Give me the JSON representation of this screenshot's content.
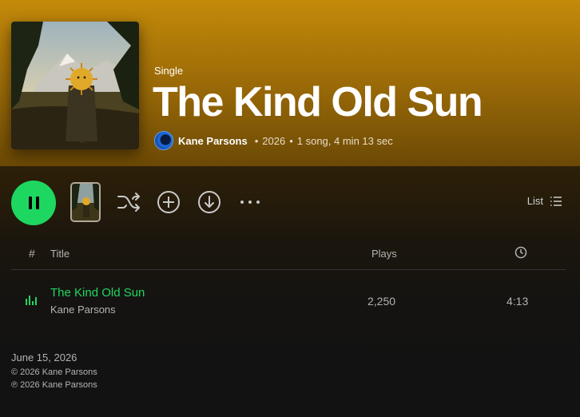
{
  "album": {
    "type_label": "Single",
    "title": "The Kind Old Sun",
    "artist": "Kane Parsons",
    "year": "2026",
    "summary": "1 song, 4 min 13 sec",
    "separator": "•"
  },
  "controls": {
    "view_label": "List",
    "more_label": "···"
  },
  "table": {
    "headers": {
      "number": "#",
      "title": "Title",
      "plays": "Plays"
    },
    "tracks": [
      {
        "title": "The Kind Old Sun",
        "artist": "Kane Parsons",
        "plays": "2,250",
        "duration": "4:13",
        "playing": true
      }
    ]
  },
  "footer": {
    "release_date": "June 15, 2026",
    "copyright": "© 2026 Kane Parsons",
    "phonogram": "℗ 2026 Kane Parsons"
  },
  "colors": {
    "accent": "#1ed760",
    "header_gradient_top": "#c48a0a",
    "background": "#121212"
  },
  "icons": [
    "pause-icon",
    "shuffle-icon",
    "add-icon",
    "download-icon",
    "more-icon",
    "list-icon",
    "clock-icon",
    "equalizer-icon"
  ]
}
